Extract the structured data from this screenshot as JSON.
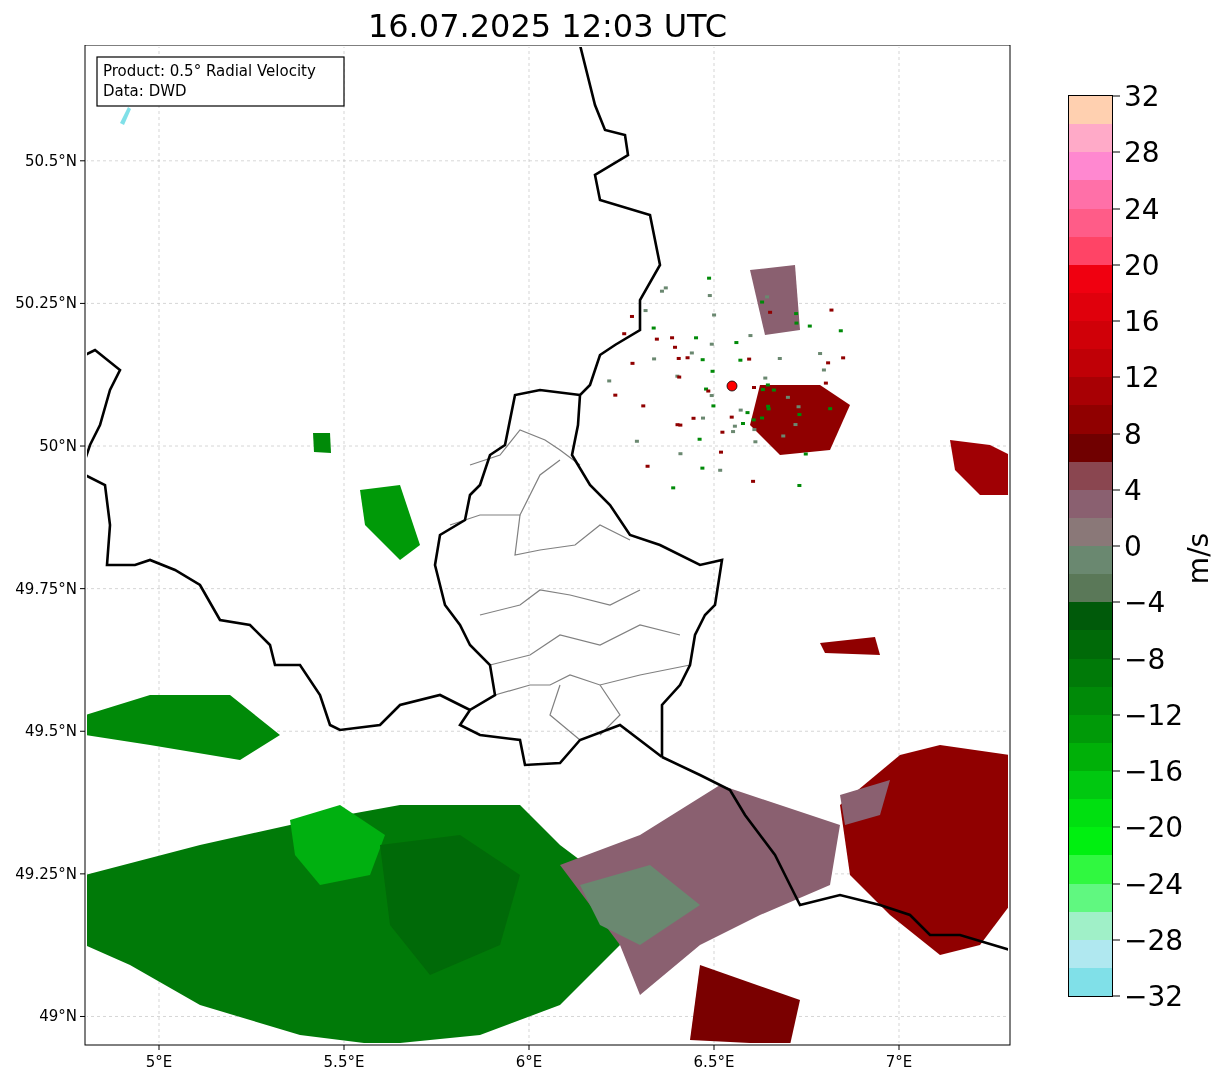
{
  "title": "16.07.2025 12:03 UTC",
  "map": {
    "info": [
      "Product: 0.5° Radial Velocity",
      "Data: DWD"
    ],
    "y_ticks": [
      "50.5°N",
      "50.25°N",
      "50°N",
      "49.75°N",
      "49.5°N",
      "49.25°N",
      "49°N"
    ],
    "x_ticks": [
      "5°E",
      "5.5°E",
      "6°E",
      "6.5°E",
      "7°E"
    ]
  },
  "colorbar": {
    "label": "m/s",
    "ticks": [
      "32",
      "28",
      "24",
      "20",
      "16",
      "12",
      "8",
      "4",
      "0",
      "−4",
      "−8",
      "−12",
      "−16",
      "−20",
      "−24",
      "−28",
      "−32"
    ],
    "bins": [
      {
        "color": "#ffd0b0"
      },
      {
        "color": "#ffaac8"
      },
      {
        "color": "#ff88d0"
      },
      {
        "color": "#ff70a8"
      },
      {
        "color": "#ff5c88"
      },
      {
        "color": "#ff4466"
      },
      {
        "color": "#f00010"
      },
      {
        "color": "#e0000c"
      },
      {
        "color": "#d00008"
      },
      {
        "color": "#c00006"
      },
      {
        "color": "#a80004"
      },
      {
        "color": "#900000"
      },
      {
        "color": "#700000"
      },
      {
        "color": "#8a4650"
      },
      {
        "color": "#8a6070"
      },
      {
        "color": "#8a7878"
      },
      {
        "color": "#6a8870"
      },
      {
        "color": "#5a7858"
      },
      {
        "color": "#005a0a"
      },
      {
        "color": "#006a08"
      },
      {
        "color": "#007a08"
      },
      {
        "color": "#008a08"
      },
      {
        "color": "#009a08"
      },
      {
        "color": "#00b008"
      },
      {
        "color": "#00c810"
      },
      {
        "color": "#00e010"
      },
      {
        "color": "#00f010"
      },
      {
        "color": "#30f840"
      },
      {
        "color": "#60f880"
      },
      {
        "color": "#a0f0c8"
      },
      {
        "color": "#b0e8f0"
      },
      {
        "color": "#80e0e8"
      }
    ]
  }
}
